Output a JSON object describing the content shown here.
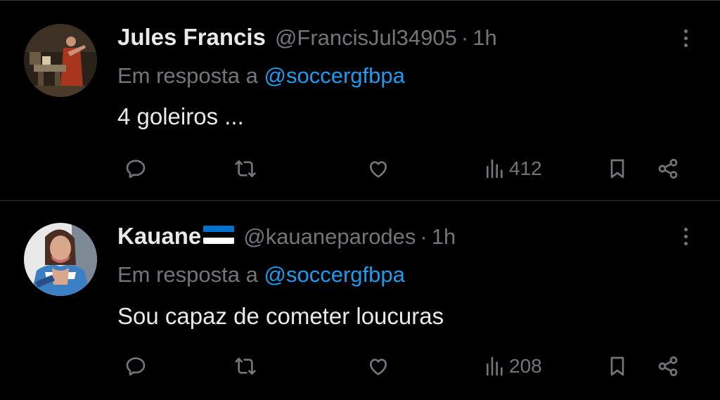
{
  "tweets": [
    {
      "name": "Jules Francis",
      "has_flag": false,
      "handle": "@FrancisJul34905",
      "separator": "·",
      "time": "1h",
      "reply_prefix": "Em resposta a",
      "reply_mention": "@soccergfbpa",
      "text": "4 goleiros ...",
      "views": "412"
    },
    {
      "name": "Kauane",
      "has_flag": true,
      "flag_colors": [
        "#0072ce",
        "#000000",
        "#ffffff"
      ],
      "handle": "@kauaneparodes",
      "separator": "·",
      "time": "1h",
      "reply_prefix": "Em resposta a",
      "reply_mention": "@soccergfbpa",
      "text": "Sou capaz de cometer loucuras",
      "views": "208"
    }
  ],
  "icons": {
    "reply": "speech-bubble-icon",
    "retweet": "repost-icon",
    "like": "heart-icon",
    "views": "bar-chart-icon",
    "bookmark": "bookmark-icon",
    "share": "share-icon",
    "more": "more-vertical-icon"
  },
  "colors": {
    "background": "#000000",
    "text": "#e7e9ea",
    "muted": "#71767b",
    "link": "#1d9bf0",
    "divider": "#2f3336"
  }
}
